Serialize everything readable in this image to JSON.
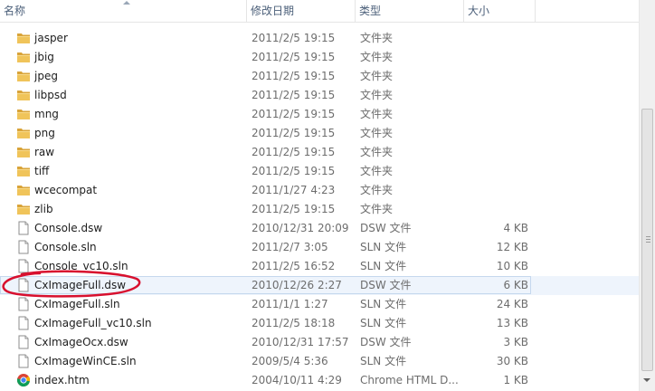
{
  "columns": {
    "name": "名称",
    "date": "修改日期",
    "type": "类型",
    "size": "大小"
  },
  "colors": {
    "header_text": "#4c607a",
    "selection_bg": "#eef4fc",
    "selection_border": "#c5d8ee",
    "folder": "#e8b84a",
    "annotation": "#d8102e"
  },
  "files": [
    {
      "name": "jasper",
      "date": "2011/2/5 19:15",
      "type": "文件夹",
      "size": "",
      "icon": "folder-icon"
    },
    {
      "name": "jbig",
      "date": "2011/2/5 19:15",
      "type": "文件夹",
      "size": "",
      "icon": "folder-icon"
    },
    {
      "name": "jpeg",
      "date": "2011/2/5 19:15",
      "type": "文件夹",
      "size": "",
      "icon": "folder-icon"
    },
    {
      "name": "libpsd",
      "date": "2011/2/5 19:15",
      "type": "文件夹",
      "size": "",
      "icon": "folder-icon"
    },
    {
      "name": "mng",
      "date": "2011/2/5 19:15",
      "type": "文件夹",
      "size": "",
      "icon": "folder-icon"
    },
    {
      "name": "png",
      "date": "2011/2/5 19:15",
      "type": "文件夹",
      "size": "",
      "icon": "folder-icon"
    },
    {
      "name": "raw",
      "date": "2011/2/5 19:15",
      "type": "文件夹",
      "size": "",
      "icon": "folder-icon"
    },
    {
      "name": "tiff",
      "date": "2011/2/5 19:15",
      "type": "文件夹",
      "size": "",
      "icon": "folder-icon"
    },
    {
      "name": "wcecompat",
      "date": "2011/1/27 4:23",
      "type": "文件夹",
      "size": "",
      "icon": "folder-icon"
    },
    {
      "name": "zlib",
      "date": "2011/2/5 19:15",
      "type": "文件夹",
      "size": "",
      "icon": "folder-icon"
    },
    {
      "name": "Console.dsw",
      "date": "2010/12/31 20:09",
      "type": "DSW 文件",
      "size": "4 KB",
      "icon": "file-icon"
    },
    {
      "name": "Console.sln",
      "date": "2011/2/7 3:05",
      "type": "SLN 文件",
      "size": "12 KB",
      "icon": "file-icon"
    },
    {
      "name": "Console_vc10.sln",
      "date": "2011/2/5 16:52",
      "type": "SLN 文件",
      "size": "10 KB",
      "icon": "file-icon"
    },
    {
      "name": "CxImageFull.dsw",
      "date": "2010/12/26 2:27",
      "type": "DSW 文件",
      "size": "6 KB",
      "icon": "file-icon"
    },
    {
      "name": "CxImageFull.sln",
      "date": "2011/1/1 1:27",
      "type": "SLN 文件",
      "size": "24 KB",
      "icon": "file-icon"
    },
    {
      "name": "CxImageFull_vc10.sln",
      "date": "2011/2/5 18:18",
      "type": "SLN 文件",
      "size": "13 KB",
      "icon": "file-icon"
    },
    {
      "name": "CxImageOcx.dsw",
      "date": "2010/12/31 17:57",
      "type": "DSW 文件",
      "size": "3 KB",
      "icon": "file-icon"
    },
    {
      "name": "CxImageWinCE.sln",
      "date": "2009/5/4 5:36",
      "type": "SLN 文件",
      "size": "30 KB",
      "icon": "file-icon"
    },
    {
      "name": "index.htm",
      "date": "2004/10/11 4:29",
      "type": "Chrome HTML D...",
      "size": "1 KB",
      "icon": "chrome-icon"
    }
  ]
}
